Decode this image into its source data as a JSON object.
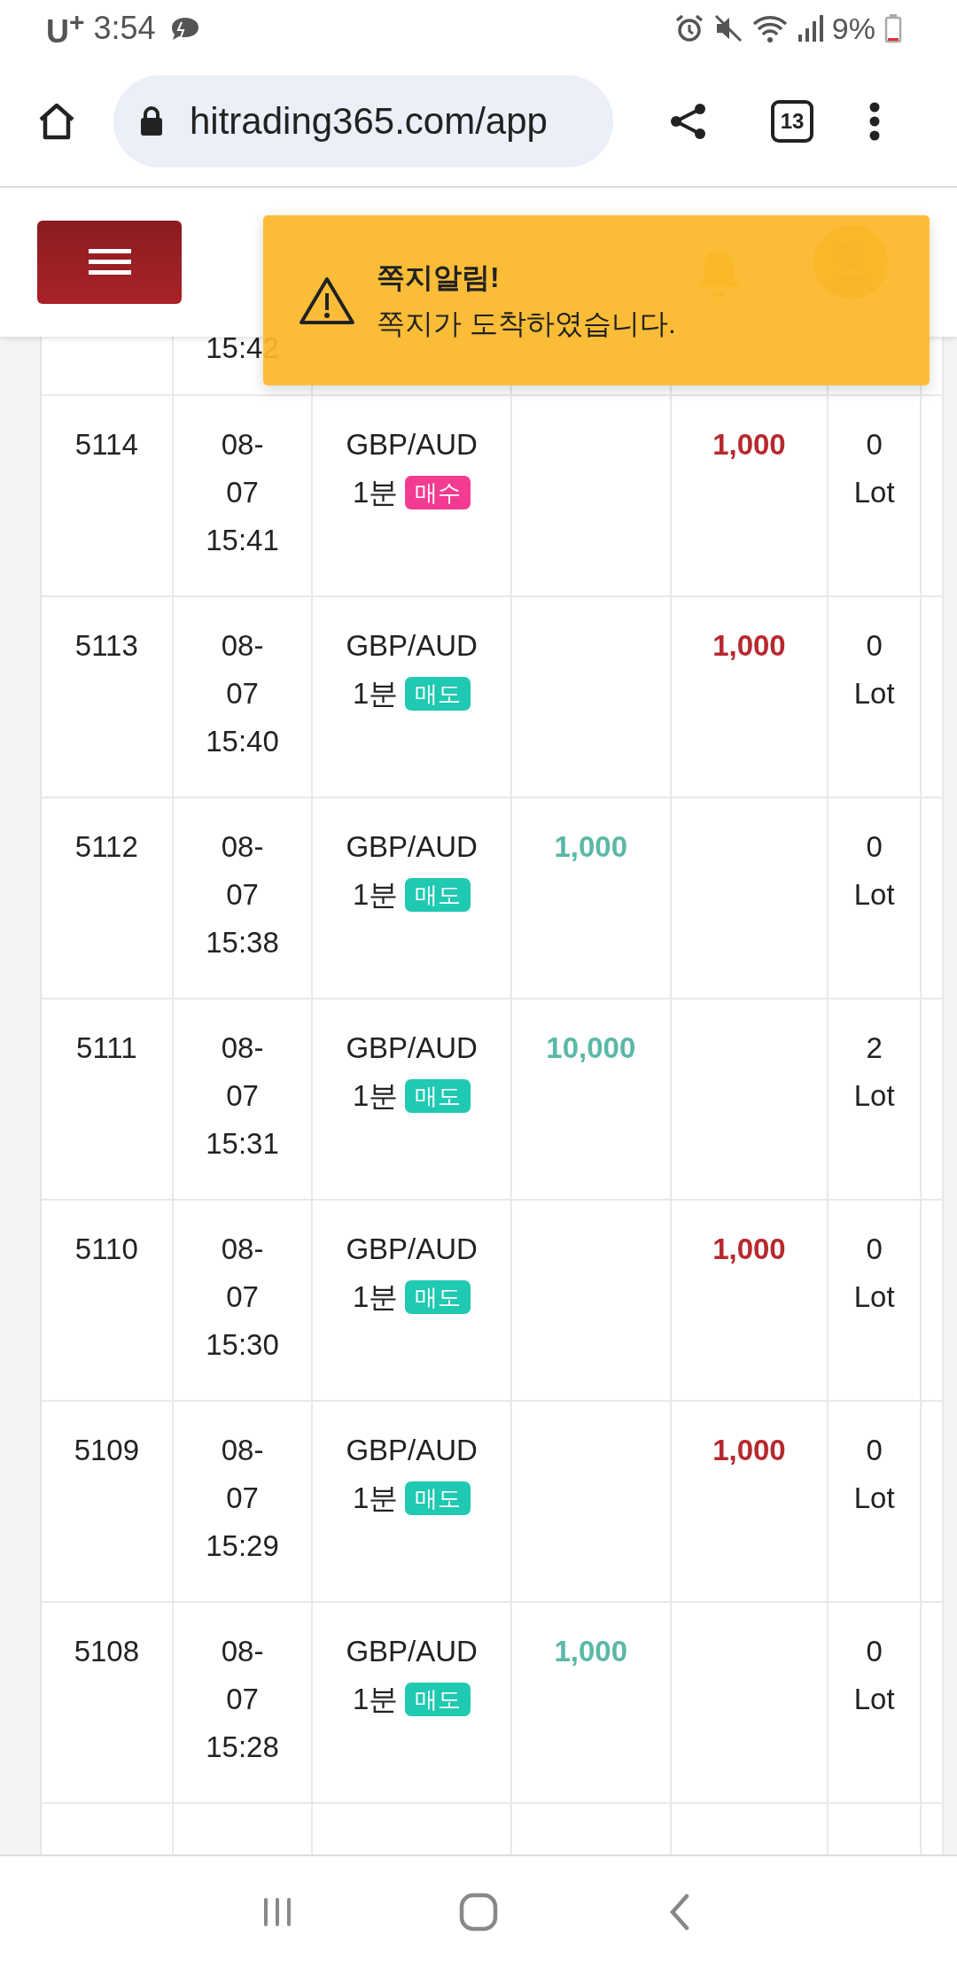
{
  "status_bar": {
    "carrier": "U$^{+}$",
    "time": "3:54",
    "battery": "9%"
  },
  "browser": {
    "url": "hitrading365.com/app",
    "tab_count": "13"
  },
  "toast": {
    "title": "쪽지알림!",
    "message": "쪽지가 도착하였습니다."
  },
  "table": {
    "top_partial_row": {
      "date": "15:42"
    },
    "rows": [
      {
        "no": "5114",
        "date": "08-07 15:41",
        "pair": "GBP/AUD",
        "period": "1분",
        "side": {
          "label": "매수",
          "kind": "buy"
        },
        "column_5": "1,000",
        "lot": "0 Lot"
      },
      {
        "no": "5113",
        "date": "08-07 15:40",
        "pair": "GBP/AUD",
        "period": "1분",
        "side": {
          "label": "매도",
          "kind": "sell"
        },
        "column_5": "1,000",
        "lot": "0 Lot"
      },
      {
        "no": "5112",
        "date": "08-07 15:38",
        "pair": "GBP/AUD",
        "period": "1분",
        "side": {
          "label": "매도",
          "kind": "sell"
        },
        "column_4": "1,000",
        "lot": "0 Lot"
      },
      {
        "no": "5111",
        "date": "08-07 15:31",
        "pair": "GBP/AUD",
        "period": "1분",
        "side": {
          "label": "매도",
          "kind": "sell"
        },
        "column_4": "10,000",
        "lot": "2 Lot"
      },
      {
        "no": "5110",
        "date": "08-07 15:30",
        "pair": "GBP/AUD",
        "period": "1분",
        "side": {
          "label": "매도",
          "kind": "sell"
        },
        "column_5": "1,000",
        "lot": "0 Lot"
      },
      {
        "no": "5109",
        "date": "08-07 15:29",
        "pair": "GBP/AUD",
        "period": "1분",
        "side": {
          "label": "매도",
          "kind": "sell"
        },
        "column_5": "1,000",
        "lot": "0 Lot"
      },
      {
        "no": "5108",
        "date": "08-07 15:28",
        "pair": "GBP/AUD",
        "period": "1분",
        "side": {
          "label": "매도",
          "kind": "sell"
        },
        "column_4": "1,000",
        "lot": "0 Lot"
      }
    ]
  }
}
